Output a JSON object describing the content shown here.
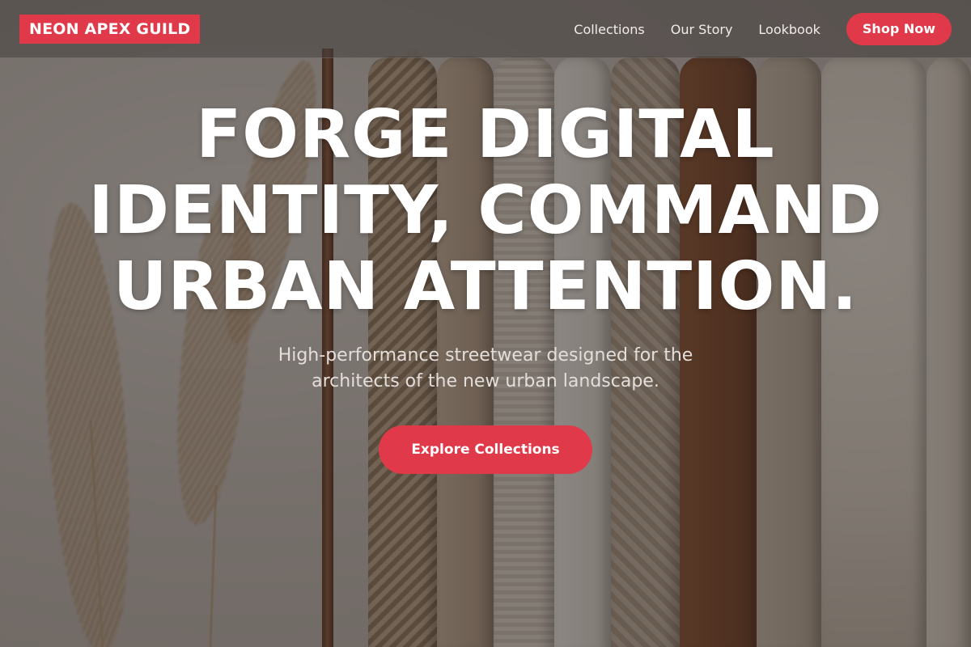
{
  "header": {
    "brand": "NEON APEX GUILD",
    "nav": [
      {
        "label": "Collections"
      },
      {
        "label": "Our Story"
      },
      {
        "label": "Lookbook"
      }
    ],
    "cta_label": "Shop Now"
  },
  "hero": {
    "title": "FORGE DIGITAL IDENTITY, COMMAND URBAN ATTENTION.",
    "subtitle": "High-performance streetwear designed for the architects of the new urban landscape.",
    "cta_label": "Explore Collections"
  },
  "colors": {
    "accent": "#e03a4a",
    "text": "#ffffff"
  }
}
